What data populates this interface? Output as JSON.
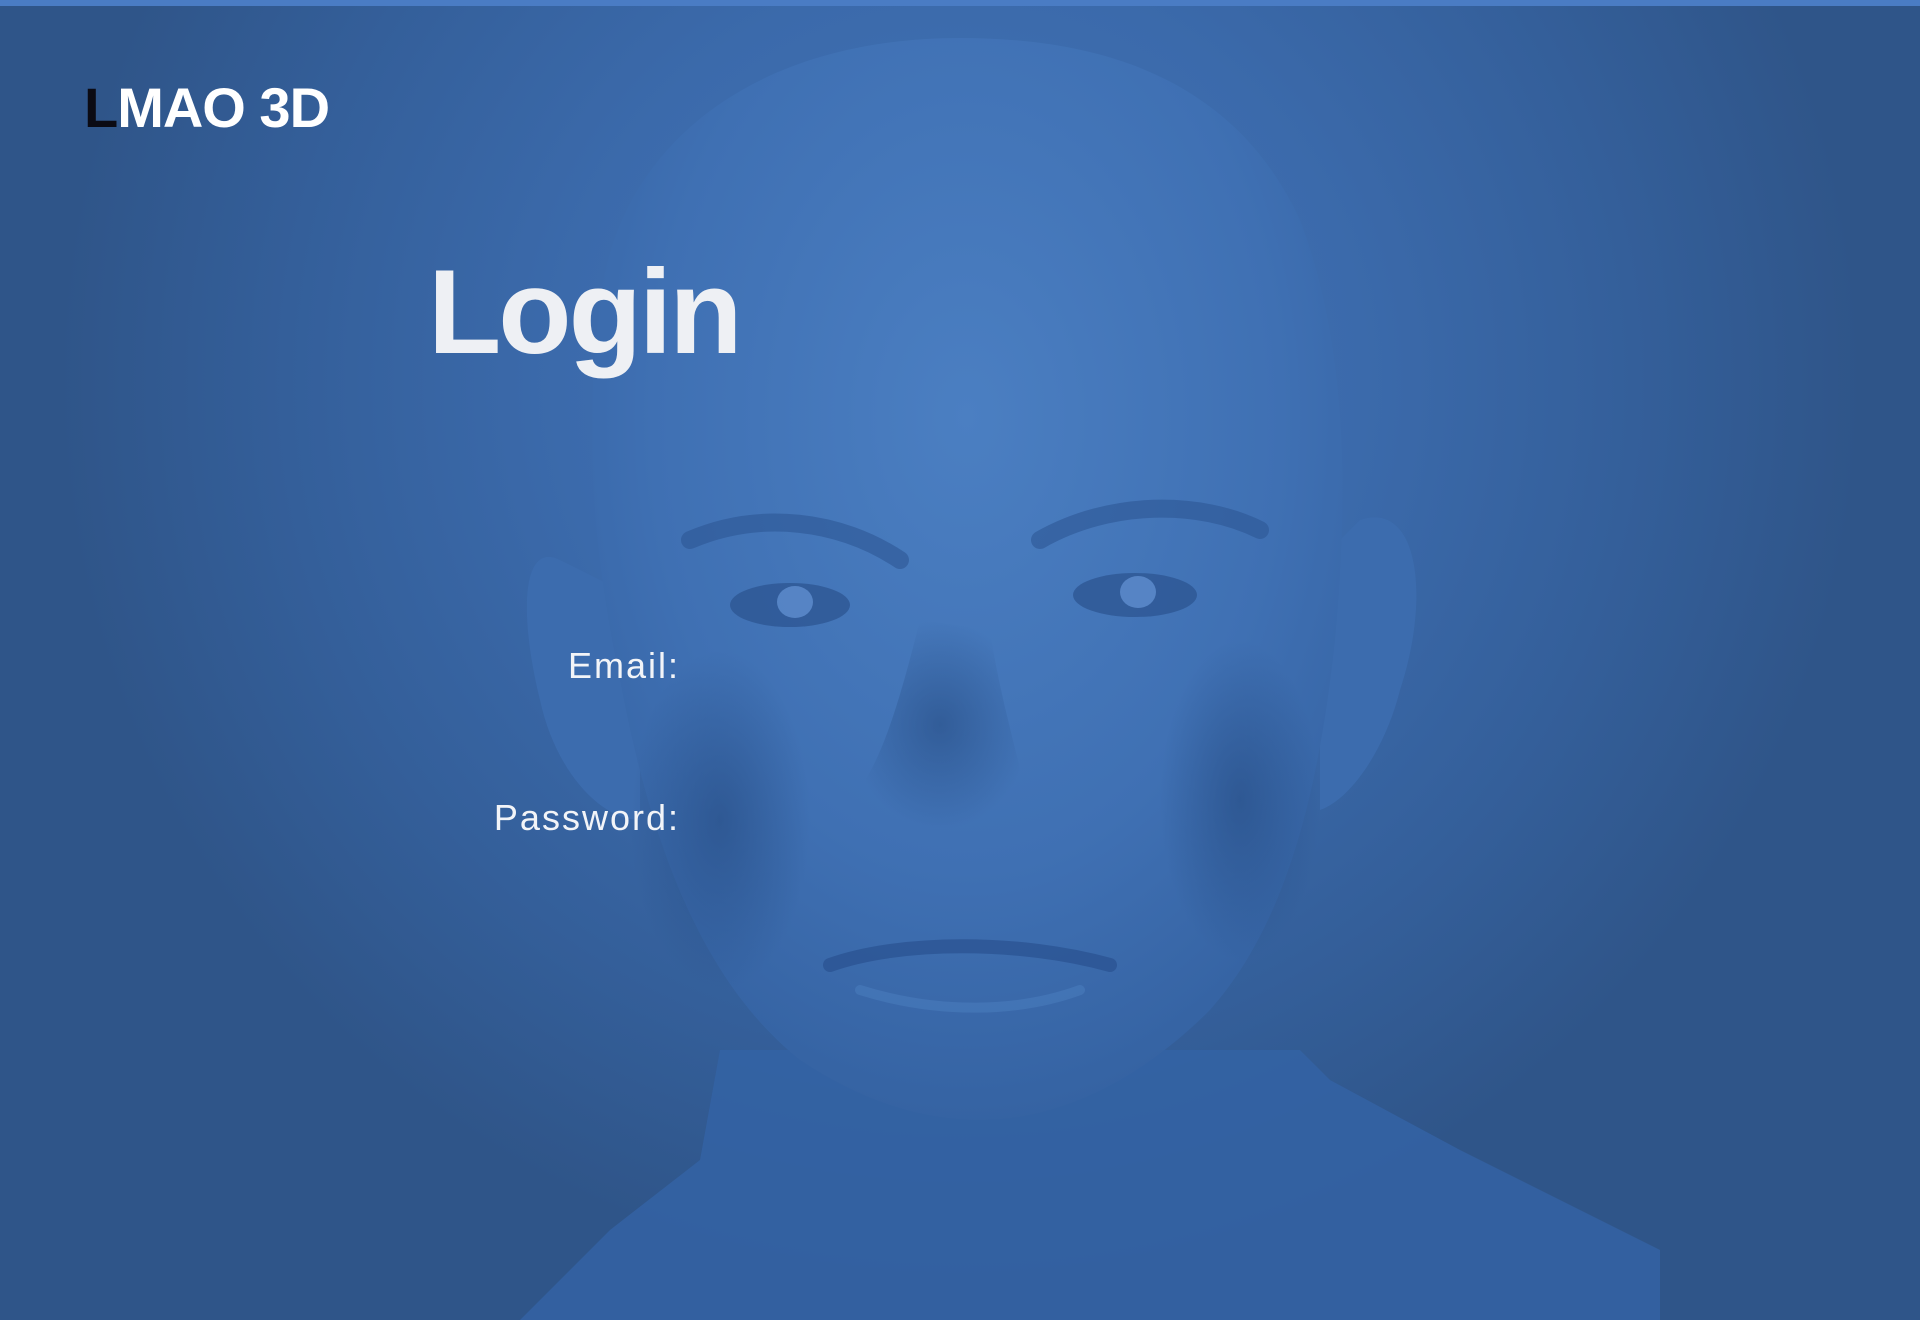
{
  "brand": {
    "first_letter": "L",
    "rest": "MAO 3D"
  },
  "page": {
    "title": "Login"
  },
  "form": {
    "email_label": "Email:",
    "email_value": "",
    "password_label": "Password:",
    "password_value": ""
  },
  "colors": {
    "background": "#3a68a8",
    "accent_strip": "#4a7cc4",
    "text": "#eef0f4",
    "logo_first_letter": "#0b0b14"
  }
}
